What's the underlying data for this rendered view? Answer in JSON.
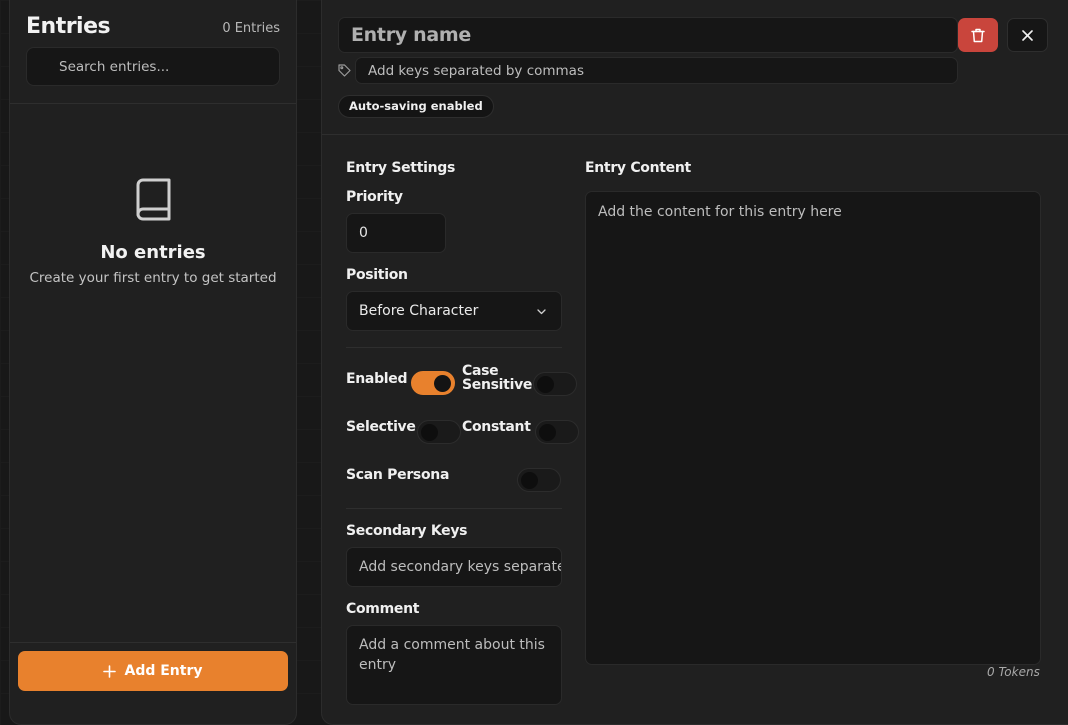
{
  "sidebar": {
    "title": "Entries",
    "count": "0 Entries",
    "search_placeholder": "Search entries...",
    "empty_title": "No entries",
    "empty_subtitle": "Create your first entry to get started",
    "add_button_label": "Add Entry"
  },
  "editor": {
    "name_placeholder": "Entry name",
    "keys_placeholder": "Add keys separated by commas",
    "autosave_badge": "Auto-saving enabled",
    "settings_title": "Entry Settings",
    "priority_label": "Priority",
    "priority_value": "0",
    "position_label": "Position",
    "position_value": "Before Character",
    "toggles": {
      "enabled": {
        "label": "Enabled",
        "on": true
      },
      "case_sensitive": {
        "label_line1": "Case",
        "label_line2": "Sensitive",
        "on": false
      },
      "selective": {
        "label": "Selective",
        "on": false
      },
      "constant": {
        "label": "Constant",
        "on": false
      },
      "scan_persona": {
        "label": "Scan Persona",
        "on": false
      }
    },
    "secondary_keys_label": "Secondary Keys",
    "secondary_keys_placeholder": "Add secondary keys separated by commas",
    "comment_label": "Comment",
    "comment_placeholder": "Add a comment about this entry",
    "content_label": "Entry Content",
    "content_placeholder": "Add the content for this entry here",
    "tokens": "0 Tokens"
  },
  "colors": {
    "accent": "#e8812d",
    "danger": "#c9453c",
    "panel": "#202020",
    "field": "#161616"
  },
  "icons": {
    "search": "search-icon",
    "book": "book-icon",
    "plus": "plus-icon",
    "trash": "trash-icon",
    "close": "close-icon",
    "tag": "tag-icon",
    "chevron": "chevron-down-icon"
  }
}
